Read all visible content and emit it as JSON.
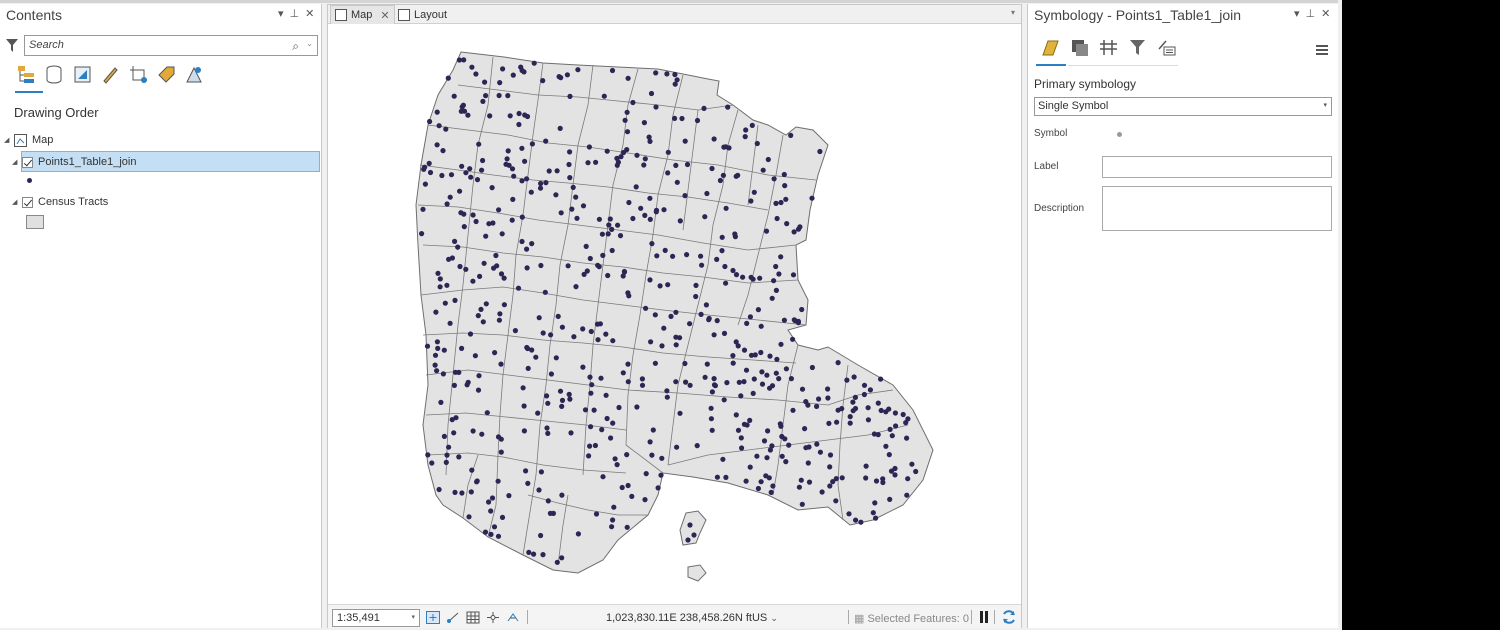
{
  "contents": {
    "title": "Contents",
    "search_placeholder": "Search",
    "drawing_order": "Drawing Order",
    "map_label": "Map",
    "layers": [
      {
        "name": "Points1_Table1_join",
        "checked": true,
        "selected": true
      },
      {
        "name": "Census Tracts",
        "checked": true,
        "selected": false
      }
    ],
    "toolbar_icons": [
      "list-by-drawing-order-icon",
      "list-by-data-source-icon",
      "list-by-selection-icon",
      "list-by-editing-icon",
      "list-by-snapping-icon",
      "list-by-labeling-icon",
      "list-by-perspective-icon"
    ]
  },
  "mapview": {
    "tabs": [
      {
        "label": "Map",
        "active": true,
        "closable": true
      },
      {
        "label": "Layout",
        "active": false,
        "closable": false
      }
    ],
    "scale": "1:35,491",
    "coordinates": "1,023,830.11E 238,458.26N ftUS",
    "selected_features": "Selected Features: 0",
    "point_color": "#2d2654",
    "polygon_fill": "#e3e3e3",
    "polygon_stroke": "#6e6e6e"
  },
  "symbology": {
    "title": "Symbology - Points1_Table1_join",
    "primary_label": "Primary symbology",
    "primary_value": "Single Symbol",
    "symbol_label": "Symbol",
    "label_label": "Label",
    "description_label": "Description",
    "label_value": "",
    "description_value": ""
  },
  "colors": {
    "accent": "#2b7fc2",
    "selection": "#c4def3"
  }
}
